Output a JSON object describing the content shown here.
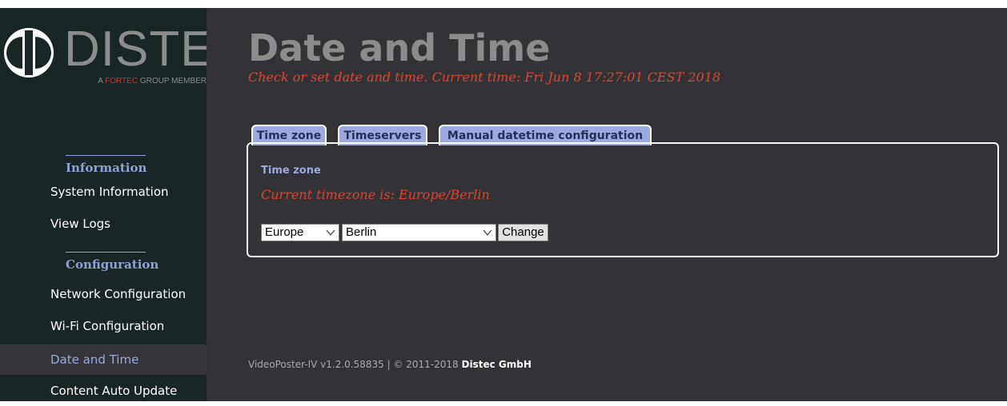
{
  "logo": {
    "word": "DISTEC",
    "tagline_prefix": "A ",
    "tagline_accent": "FORTEC",
    "tagline_suffix": " GROUP MEMBER"
  },
  "sidebar": {
    "sections": [
      {
        "heading": "Information",
        "items": [
          "System Information",
          "View Logs"
        ]
      },
      {
        "heading": "Configuration",
        "items": [
          "Network Configuration",
          "Wi-Fi Configuration",
          "Date and Time",
          "Content Auto Update"
        ]
      }
    ],
    "active_item": "Date and Time"
  },
  "header": {
    "title": "Date and Time",
    "subtitle": "Check or set date and time. Current time: Fri Jun 8 17:27:01 CEST 2018"
  },
  "tabs": [
    "Time zone",
    "Timeservers",
    "Manual datetime configuration"
  ],
  "panel": {
    "title": "Time zone",
    "message": "Current timezone is: Europe/Berlin",
    "region_value": "Europe",
    "city_value": "Berlin",
    "change_label": "Change"
  },
  "footer": {
    "version": "VideoPoster-IV v1.2.0.58835 | © 2011-2018 ",
    "company": "Distec GmbH"
  },
  "colors": {
    "sidebar_bg": "#1a2526",
    "main_bg": "#333237",
    "accent_blue": "#9aaae0",
    "alert_red": "#e0442c"
  }
}
